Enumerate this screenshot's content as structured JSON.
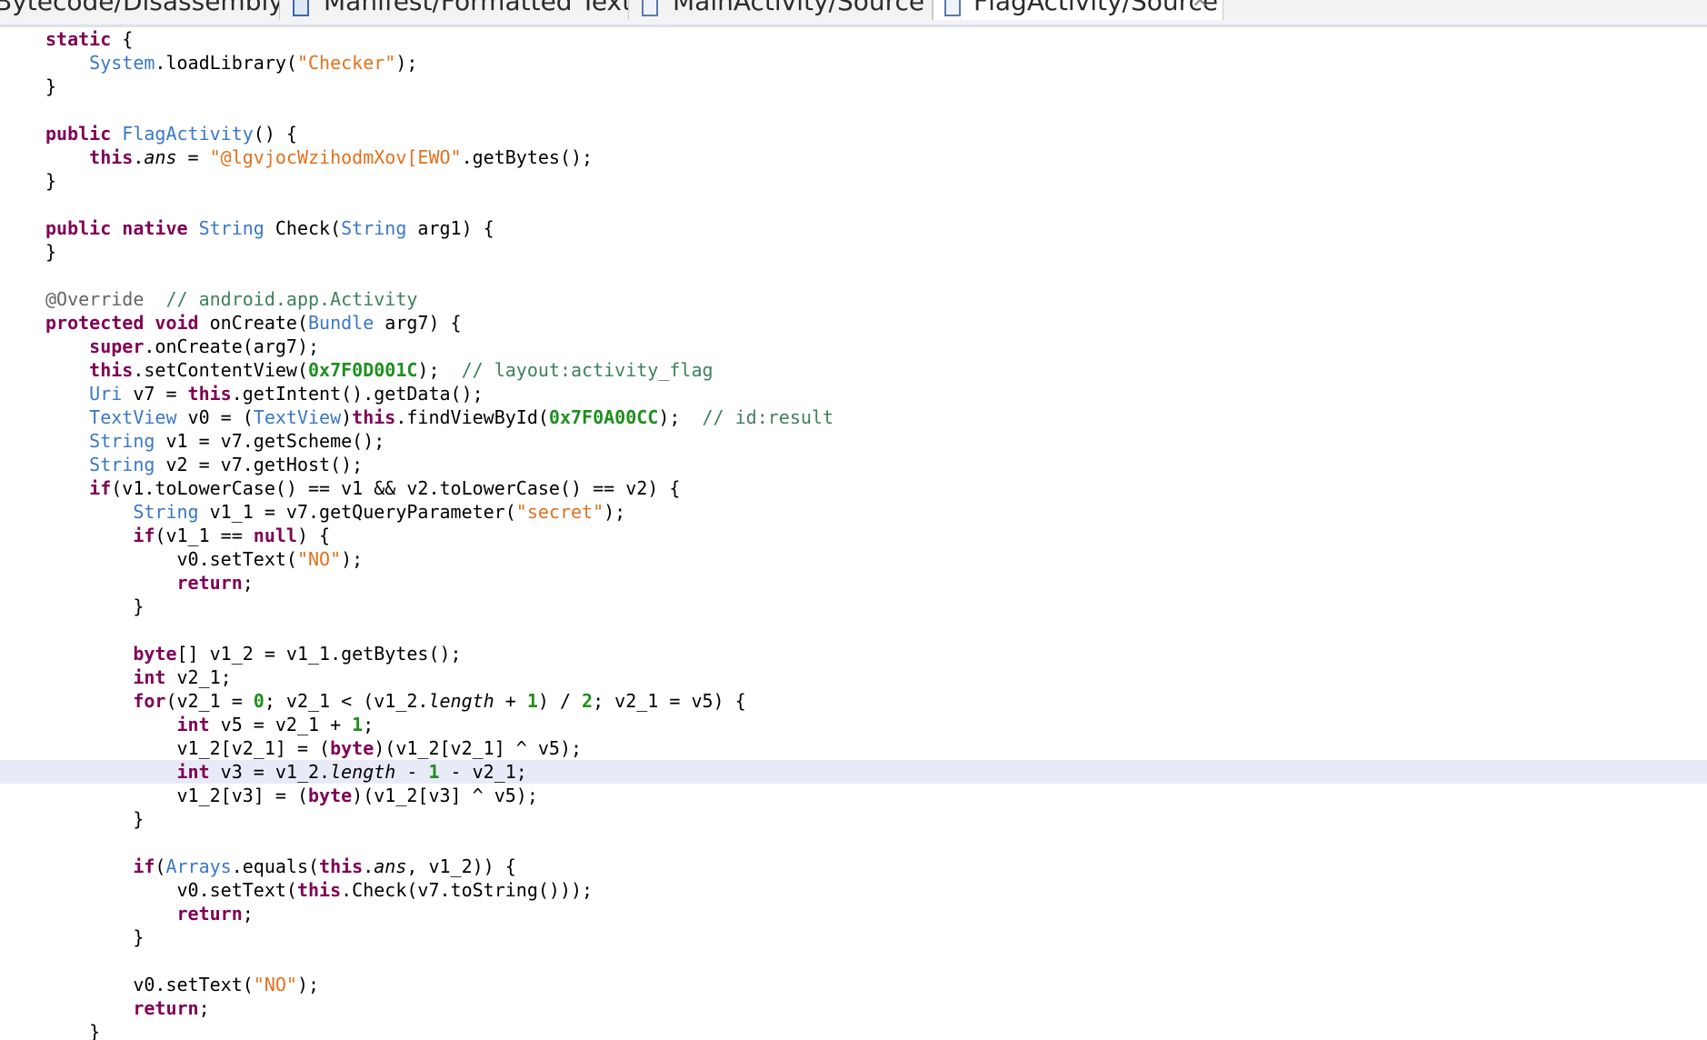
{
  "tabs": [
    {
      "label": "Bytecode/Disassembly",
      "icon": "",
      "active": false
    },
    {
      "label": "Manifest/Formatted Text",
      "icon": "manifest-file-icon",
      "active": false
    },
    {
      "label": "MainActivity/Source",
      "icon": "java-source-icon",
      "active": false
    },
    {
      "label": "FlagActivity/Source",
      "icon": "java-source-icon",
      "active": true,
      "close": "✕"
    }
  ],
  "editor": {
    "current_line_index": 31,
    "lines": [
      [
        {
          "c": "kw",
          "t": "static"
        },
        {
          "t": " {"
        }
      ],
      [
        {
          "t": "    "
        },
        {
          "c": "ty",
          "t": "System"
        },
        {
          "t": ".loadLibrary("
        },
        {
          "c": "str",
          "t": "\"Checker\""
        },
        {
          "t": ");"
        }
      ],
      [
        {
          "t": "}"
        }
      ],
      [],
      [
        {
          "c": "kw",
          "t": "public"
        },
        {
          "t": " "
        },
        {
          "c": "ty",
          "t": "FlagActivity"
        },
        {
          "t": "() {"
        }
      ],
      [
        {
          "t": "    "
        },
        {
          "c": "kw",
          "t": "this"
        },
        {
          "t": "."
        },
        {
          "c": "fld",
          "t": "ans"
        },
        {
          "t": " = "
        },
        {
          "c": "str",
          "t": "\"@lgvjocWzihodmXov[EWO\""
        },
        {
          "t": ".getBytes();"
        }
      ],
      [
        {
          "t": "}"
        }
      ],
      [],
      [
        {
          "c": "kw",
          "t": "public"
        },
        {
          "t": " "
        },
        {
          "c": "kw",
          "t": "native"
        },
        {
          "t": " "
        },
        {
          "c": "ty",
          "t": "String"
        },
        {
          "t": " Check("
        },
        {
          "c": "ty",
          "t": "String"
        },
        {
          "t": " arg1) {"
        }
      ],
      [
        {
          "t": "}"
        }
      ],
      [],
      [
        {
          "c": "an",
          "t": "@Override"
        },
        {
          "t": "  "
        },
        {
          "c": "cm",
          "t": "// android.app.Activity"
        }
      ],
      [
        {
          "c": "kw",
          "t": "protected"
        },
        {
          "t": " "
        },
        {
          "c": "kw",
          "t": "void"
        },
        {
          "t": " onCreate("
        },
        {
          "c": "ty",
          "t": "Bundle"
        },
        {
          "t": " arg7) {"
        }
      ],
      [
        {
          "t": "    "
        },
        {
          "c": "kw",
          "t": "super"
        },
        {
          "t": ".onCreate(arg7);"
        }
      ],
      [
        {
          "t": "    "
        },
        {
          "c": "kw",
          "t": "this"
        },
        {
          "t": ".setContentView("
        },
        {
          "c": "num",
          "t": "0x7F0D001C"
        },
        {
          "t": ");  "
        },
        {
          "c": "cm",
          "t": "// layout:activity_flag"
        }
      ],
      [
        {
          "t": "    "
        },
        {
          "c": "ty",
          "t": "Uri"
        },
        {
          "t": " v7 = "
        },
        {
          "c": "kw",
          "t": "this"
        },
        {
          "t": ".getIntent().getData();"
        }
      ],
      [
        {
          "t": "    "
        },
        {
          "c": "ty",
          "t": "TextView"
        },
        {
          "t": " v0 = ("
        },
        {
          "c": "ty",
          "t": "TextView"
        },
        {
          "t": ")"
        },
        {
          "c": "kw",
          "t": "this"
        },
        {
          "t": ".findViewById("
        },
        {
          "c": "num",
          "t": "0x7F0A00CC"
        },
        {
          "t": ");  "
        },
        {
          "c": "cm",
          "t": "// id:result"
        }
      ],
      [
        {
          "t": "    "
        },
        {
          "c": "ty",
          "t": "String"
        },
        {
          "t": " v1 = v7.getScheme();"
        }
      ],
      [
        {
          "t": "    "
        },
        {
          "c": "ty",
          "t": "String"
        },
        {
          "t": " v2 = v7.getHost();"
        }
      ],
      [
        {
          "t": "    "
        },
        {
          "c": "kw",
          "t": "if"
        },
        {
          "t": "(v1.toLowerCase() == v1 && v2.toLowerCase() == v2) {"
        }
      ],
      [
        {
          "t": "        "
        },
        {
          "c": "ty",
          "t": "String"
        },
        {
          "t": " v1_1 = v7.getQueryParameter("
        },
        {
          "c": "str",
          "t": "\"secret\""
        },
        {
          "t": ");"
        }
      ],
      [
        {
          "t": "        "
        },
        {
          "c": "kw",
          "t": "if"
        },
        {
          "t": "(v1_1 == "
        },
        {
          "c": "kw",
          "t": "null"
        },
        {
          "t": ") {"
        }
      ],
      [
        {
          "t": "            v0.setText("
        },
        {
          "c": "str",
          "t": "\"NO\""
        },
        {
          "t": ");"
        }
      ],
      [
        {
          "t": "            "
        },
        {
          "c": "kw",
          "t": "return"
        },
        {
          "t": ";"
        }
      ],
      [
        {
          "t": "        }"
        }
      ],
      [],
      [
        {
          "t": "        "
        },
        {
          "c": "kw",
          "t": "byte"
        },
        {
          "t": "[] v1_2 = v1_1.getBytes();"
        }
      ],
      [
        {
          "t": "        "
        },
        {
          "c": "kw",
          "t": "int"
        },
        {
          "t": " v2_1;"
        }
      ],
      [
        {
          "t": "        "
        },
        {
          "c": "kw",
          "t": "for"
        },
        {
          "t": "(v2_1 = "
        },
        {
          "c": "num",
          "t": "0"
        },
        {
          "t": "; v2_1 < (v1_2."
        },
        {
          "c": "fld",
          "t": "length"
        },
        {
          "t": " + "
        },
        {
          "c": "num",
          "t": "1"
        },
        {
          "t": ") / "
        },
        {
          "c": "num",
          "t": "2"
        },
        {
          "t": "; v2_1 = v5) {"
        }
      ],
      [
        {
          "t": "            "
        },
        {
          "c": "kw",
          "t": "int"
        },
        {
          "t": " v5 = v2_1 + "
        },
        {
          "c": "num",
          "t": "1"
        },
        {
          "t": ";"
        }
      ],
      [
        {
          "t": "            v1_2[v2_1] = ("
        },
        {
          "c": "kw",
          "t": "byte"
        },
        {
          "t": ")(v1_2[v2_1] ^ v5);"
        }
      ],
      [
        {
          "t": "            "
        },
        {
          "c": "kw",
          "t": "int"
        },
        {
          "t": " v3 = v1_2."
        },
        {
          "c": "fld",
          "t": "length"
        },
        {
          "t": " - "
        },
        {
          "c": "num",
          "t": "1"
        },
        {
          "t": " - v2_1;"
        }
      ],
      [
        {
          "t": "            v1_2[v3] = ("
        },
        {
          "c": "kw",
          "t": "byte"
        },
        {
          "t": ")(v1_2[v3] ^ v5);"
        }
      ],
      [
        {
          "t": "        }"
        }
      ],
      [],
      [
        {
          "t": "        "
        },
        {
          "c": "kw",
          "t": "if"
        },
        {
          "t": "("
        },
        {
          "c": "ty",
          "t": "Arrays"
        },
        {
          "t": ".equals("
        },
        {
          "c": "kw",
          "t": "this"
        },
        {
          "t": "."
        },
        {
          "c": "fld",
          "t": "ans"
        },
        {
          "t": ", v1_2)) {"
        }
      ],
      [
        {
          "t": "            v0.setText("
        },
        {
          "c": "kw",
          "t": "this"
        },
        {
          "t": ".Check(v7.toString()));"
        }
      ],
      [
        {
          "t": "            "
        },
        {
          "c": "kw",
          "t": "return"
        },
        {
          "t": ";"
        }
      ],
      [
        {
          "t": "        }"
        }
      ],
      [],
      [
        {
          "t": "        v0.setText("
        },
        {
          "c": "str",
          "t": "\"NO\""
        },
        {
          "t": ");"
        }
      ],
      [
        {
          "t": "        "
        },
        {
          "c": "kw",
          "t": "return"
        },
        {
          "t": ";"
        }
      ],
      [
        {
          "t": "    }"
        }
      ]
    ]
  }
}
